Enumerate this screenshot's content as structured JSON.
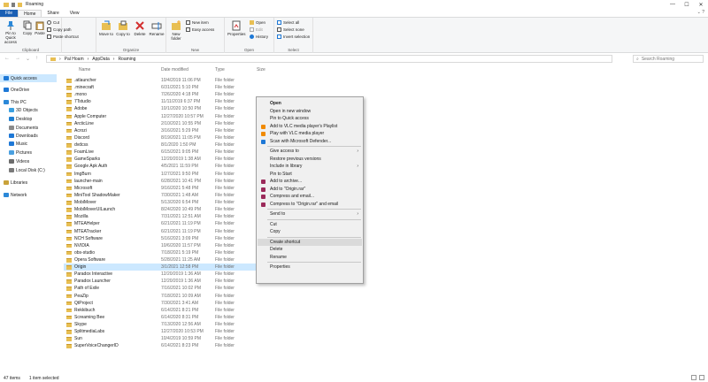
{
  "window": {
    "title": "Roaming",
    "min": "—",
    "max": "☐",
    "close": "✕"
  },
  "tabs": [
    "File",
    "Home",
    "Share",
    "View"
  ],
  "ribbon": {
    "clipboard": {
      "label": "Clipboard",
      "pin": "Pin to Quick access",
      "copy": "Copy",
      "paste": "Paste",
      "cut": "Cut",
      "copy_path": "Copy path",
      "paste_shortcut": "Paste shortcut"
    },
    "organize": {
      "label": "Organize",
      "move": "Move to",
      "copy": "Copy to",
      "delete": "Delete",
      "rename": "Rename"
    },
    "new": {
      "label": "New",
      "folder": "New folder",
      "new_item": "New item",
      "easy_access": "Easy access"
    },
    "open": {
      "label": "Open",
      "properties": "Properties",
      "open": "Open",
      "edit": "Edit",
      "history": "History"
    },
    "select": {
      "label": "Select",
      "all": "Select all",
      "none": "Select none",
      "invert": "Invert selection"
    }
  },
  "address": {
    "path": [
      "Pal Hoam",
      "AppData",
      "Roaming"
    ],
    "search_placeholder": "Search Roaming"
  },
  "sidebar": [
    {
      "label": "Quick access",
      "icon": "star-icon",
      "color": "#1e78d6"
    },
    {
      "label": "OneDrive",
      "icon": "cloud-icon",
      "color": "#1e78d6"
    },
    {
      "label": "This PC",
      "icon": "pc-icon",
      "color": "#2b88d8"
    },
    {
      "label": "3D Objects",
      "icon": "cube-icon",
      "color": "#3aa0e0"
    },
    {
      "label": "Desktop",
      "icon": "desktop-icon",
      "color": "#1f7fd1"
    },
    {
      "label": "Documents",
      "icon": "document-icon",
      "color": "#8a8a8a"
    },
    {
      "label": "Downloads",
      "icon": "download-icon",
      "color": "#1e78d6"
    },
    {
      "label": "Music",
      "icon": "music-icon",
      "color": "#1e78d6"
    },
    {
      "label": "Pictures",
      "icon": "picture-icon",
      "color": "#4aa0e0"
    },
    {
      "label": "Videos",
      "icon": "video-icon",
      "color": "#6c6c6c"
    },
    {
      "label": "Local Disk (C:)",
      "icon": "disk-icon",
      "color": "#7a7a7a"
    },
    {
      "label": "Libraries",
      "icon": "library-icon",
      "color": "#c9a23a"
    },
    {
      "label": "Network",
      "icon": "network-icon",
      "color": "#2b88d8"
    }
  ],
  "columns": {
    "name": "Name",
    "date": "Date modified",
    "type": "Type",
    "size": "Size"
  },
  "files": [
    {
      "name": ".atlauncher",
      "date": "10/4/2019 11:06 PM",
      "type": "File folder"
    },
    {
      "name": ".minecraft",
      "date": "6/31/2021 5:10 PM",
      "type": "File folder"
    },
    {
      "name": ".mono",
      "date": "7/26/2020 4:18 PM",
      "type": "File folder"
    },
    {
      "name": "7Tstudio",
      "date": "11/11/2019 6:37 PM",
      "type": "File folder"
    },
    {
      "name": "Adobe",
      "date": "10/1/2020 10:50 PM",
      "type": "File folder"
    },
    {
      "name": "Apple Computer",
      "date": "12/27/2020 10:57 PM",
      "type": "File folder"
    },
    {
      "name": "ArcticLine",
      "date": "2/10/2021 10:55 PM",
      "type": "File folder"
    },
    {
      "name": "Acrozi",
      "date": "3/16/2021 5:29 PM",
      "type": "File folder"
    },
    {
      "name": "Discord",
      "date": "8/19/2021 11:05 PM",
      "type": "File folder"
    },
    {
      "name": "dvdcss",
      "date": "8/1/2020 1:50 PM",
      "type": "File folder"
    },
    {
      "name": "FoamLive",
      "date": "6/15/2021 9:05 PM",
      "type": "File folder"
    },
    {
      "name": "GameSparks",
      "date": "12/20/2019 1:38 AM",
      "type": "File folder"
    },
    {
      "name": "Google Apk Auth",
      "date": "4/5/2021 11:59 PM",
      "type": "File folder"
    },
    {
      "name": "ImgBurn",
      "date": "1/27/2021 9:50 PM",
      "type": "File folder"
    },
    {
      "name": "launcher-main",
      "date": "6/28/2021 10:41 PM",
      "type": "File folder"
    },
    {
      "name": "Microsoft",
      "date": "9/16/2021 5:48 PM",
      "type": "File folder"
    },
    {
      "name": "MiniTool ShadowMaker",
      "date": "7/30/2021 1:48 AM",
      "type": "File folder"
    },
    {
      "name": "MobiMover",
      "date": "5/13/2020 6:54 PM",
      "type": "File folder"
    },
    {
      "name": "MobiMoverUILaunch",
      "date": "8/24/2020 10:49 PM",
      "type": "File folder"
    },
    {
      "name": "Mozilla",
      "date": "7/31/2021 12:51 AM",
      "type": "File folder"
    },
    {
      "name": "MTEAHelper",
      "date": "6/21/2021 11:19 PM",
      "type": "File folder"
    },
    {
      "name": "MTEATracker",
      "date": "6/21/2021 11:19 PM",
      "type": "File folder"
    },
    {
      "name": "NCH Software",
      "date": "5/16/2021 3:09 PM",
      "type": "File folder"
    },
    {
      "name": "NVIDIA",
      "date": "10/6/2020 11:57 PM",
      "type": "File folder"
    },
    {
      "name": "obs-studio",
      "date": "7/18/2021 5:19 PM",
      "type": "File folder"
    },
    {
      "name": "Opera Software",
      "date": "5/28/2021 11:25 AM",
      "type": "File folder"
    },
    {
      "name": "Origin",
      "date": "3/1/2021 12:58 PM",
      "type": "File folder"
    },
    {
      "name": "Paradox Interactive",
      "date": "12/20/2019 1:36 AM",
      "type": "File folder"
    },
    {
      "name": "Paradox Launcher",
      "date": "12/20/2019 1:36 AM",
      "type": "File folder"
    },
    {
      "name": "Path of Exile",
      "date": "7/16/2021 10:02 PM",
      "type": "File folder"
    },
    {
      "name": "PeaZip",
      "date": "7/18/2021 10:09 AM",
      "type": "File folder"
    },
    {
      "name": "QtProject",
      "date": "7/30/2021 3:41 AM",
      "type": "File folder"
    },
    {
      "name": "Rekkibuch",
      "date": "6/14/2021 8:21 PM",
      "type": "File folder"
    },
    {
      "name": "Screaming Bee",
      "date": "6/14/2020 8:31 PM",
      "type": "File folder"
    },
    {
      "name": "Skype",
      "date": "7/13/2020 12:56 AM",
      "type": "File folder"
    },
    {
      "name": "SplitmediaLabs",
      "date": "12/27/2020 10:53 PM",
      "type": "File folder"
    },
    {
      "name": "Sun",
      "date": "10/4/2019 10:59 PM",
      "type": "File folder"
    },
    {
      "name": "SuperVoiceChangerID",
      "date": "6/14/2021 8:23 PM",
      "type": "File folder"
    }
  ],
  "context_menu": [
    {
      "label": "Open",
      "bold": true
    },
    {
      "label": "Open in new window"
    },
    {
      "label": "Pin to Quick access"
    },
    {
      "label": "Add to VLC media player's Playlist",
      "icon": "vlc-icon",
      "color": "#f08a00"
    },
    {
      "label": "Play with VLC media player",
      "icon": "vlc-icon",
      "color": "#f08a00"
    },
    {
      "label": "Scan with Microsoft Defender...",
      "icon": "defender-icon",
      "color": "#1e78d6"
    },
    {
      "sep": true
    },
    {
      "label": "Give access to",
      "arrow": true
    },
    {
      "label": "Restore previous versions"
    },
    {
      "label": "Include in library",
      "arrow": true
    },
    {
      "label": "Pin to Start"
    },
    {
      "label": "Add to archive...",
      "icon": "winrar-icon",
      "color": "#9b2a5a"
    },
    {
      "label": "Add to \"Origin.rar\"",
      "icon": "winrar-icon",
      "color": "#9b2a5a"
    },
    {
      "label": "Compress and email...",
      "icon": "winrar-icon",
      "color": "#9b2a5a"
    },
    {
      "label": "Compress to \"Origin.rar\" and email",
      "icon": "winrar-icon",
      "color": "#9b2a5a"
    },
    {
      "sep": true
    },
    {
      "label": "Send to",
      "arrow": true
    },
    {
      "sep": true
    },
    {
      "label": "Cut"
    },
    {
      "label": "Copy"
    },
    {
      "sep": true
    },
    {
      "label": "Create shortcut",
      "hl": true
    },
    {
      "label": "Delete"
    },
    {
      "label": "Rename"
    },
    {
      "sep": true
    },
    {
      "label": "Properties"
    }
  ],
  "status": {
    "count": "47 items",
    "selected": "1 item selected"
  }
}
